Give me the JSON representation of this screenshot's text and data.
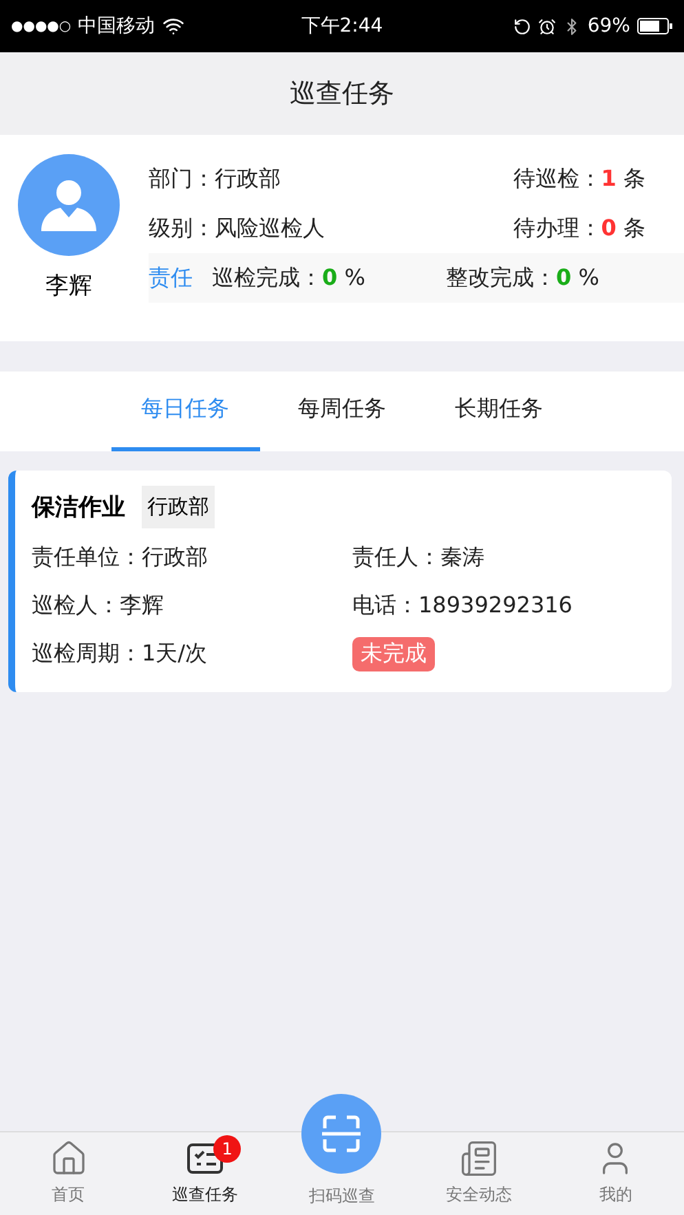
{
  "status_bar": {
    "signal": "●●●●○",
    "carrier": "中国移动",
    "time": "下午2:44",
    "battery": "69%"
  },
  "header": {
    "title": "巡查任务"
  },
  "profile": {
    "name": "李辉",
    "fields": [
      {
        "label": "部门：",
        "value": "行政部",
        "pending_label": "待巡检：",
        "pending_count": "1",
        "pending_unit": "条"
      },
      {
        "label": "级别：",
        "value": "风险巡检人",
        "pending_label": "待办理：",
        "pending_count": "0",
        "pending_unit": "条"
      }
    ],
    "stats_tag": "责任",
    "stats": [
      {
        "label": "巡检完成：",
        "value": "0",
        "unit": "%"
      },
      {
        "label": "整改完成：",
        "value": "0",
        "unit": "%"
      }
    ]
  },
  "tabs": [
    {
      "label": "每日任务",
      "selected": true
    },
    {
      "label": "每周任务",
      "selected": false
    },
    {
      "label": "长期任务",
      "selected": false
    }
  ],
  "tasks": [
    {
      "title": "保洁作业",
      "dept": "行政部",
      "unit": "责任单位：行政部",
      "owner": "责任人：秦涛",
      "inspector": "巡检人：李辉",
      "phone": "电话：18939292316",
      "cycle": "巡检周期：1天/次",
      "status": "未完成",
      "done": false
    }
  ],
  "nav": [
    {
      "kind": "home",
      "label": "首页",
      "selected": false
    },
    {
      "kind": "tasks",
      "label": "巡查任务",
      "selected": true,
      "badge": "1"
    },
    {
      "kind": "scan",
      "label": "扫码巡查",
      "selected": false
    },
    {
      "kind": "news",
      "label": "安全动态",
      "selected": false
    },
    {
      "kind": "user",
      "label": "我的",
      "selected": false
    }
  ]
}
